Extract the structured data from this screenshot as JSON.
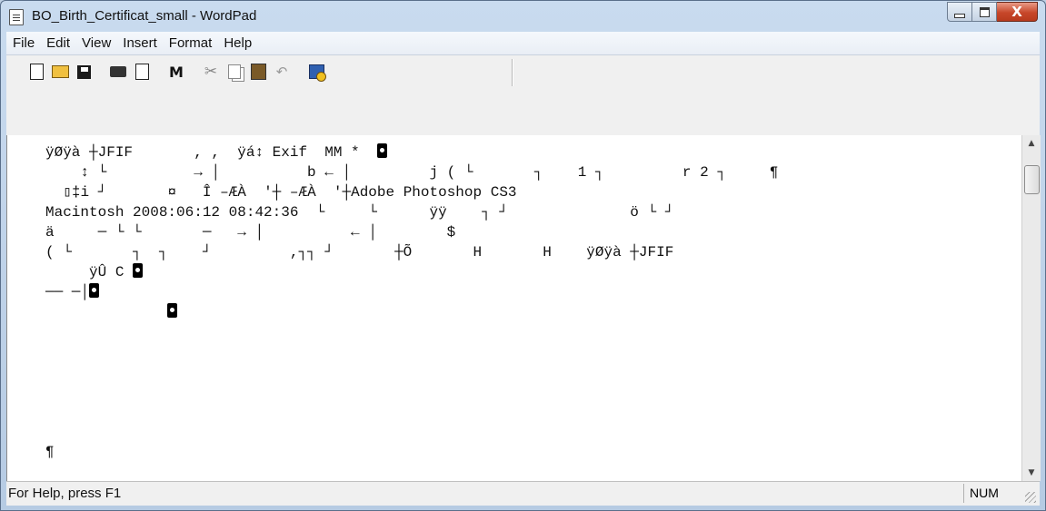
{
  "window": {
    "title": "BO_Birth_Certificat_small - WordPad",
    "caption_close": "X"
  },
  "menu": [
    "File",
    "Edit",
    "View",
    "Insert",
    "Format",
    "Help"
  ],
  "toolbar": {
    "find_glyph": "ẞ",
    "cut_glyph": "✂",
    "undo_glyph": "↶"
  },
  "document": {
    "lines": [
      {
        "text": "ÿØÿà ┼JFIF       , ,  ÿá↕ Exif  MM *  ",
        "block": true
      },
      {
        "text": "    ↕ └          → │          b ← │         j ( └       ┐    1 ┐         r 2 ┐     ¶",
        "block": false
      },
      {
        "text": "  ▯‡i ┘       ¤   Î ‒ÆÀ  '┼ ‒ÆÀ  '┼Adobe Photoshop CS3",
        "block": false
      },
      {
        "text": "Macintosh 2008:06:12 08:42:36  └     └      ÿÿ    ┐ ┘              ö └ ┘",
        "block": false
      },
      {
        "text": "ä     ─ └ └       ─   → │          ← │        $",
        "block": false
      },
      {
        "text": "( └       ┐  ┐    ┘         ,┐┐ ┘       ┼Õ       H       H    ÿØÿà ┼JFIF",
        "block": false
      },
      {
        "text": "     ÿÛ C ",
        "block": true
      },
      {
        "text": "── ─│",
        "block": true
      },
      {
        "text": "              ",
        "block": true
      }
    ],
    "pilcrow": "¶"
  },
  "status": {
    "help_text": "For Help, press F1",
    "num": "NUM"
  },
  "scrollbar": {
    "up": "▲",
    "down": "▼"
  }
}
